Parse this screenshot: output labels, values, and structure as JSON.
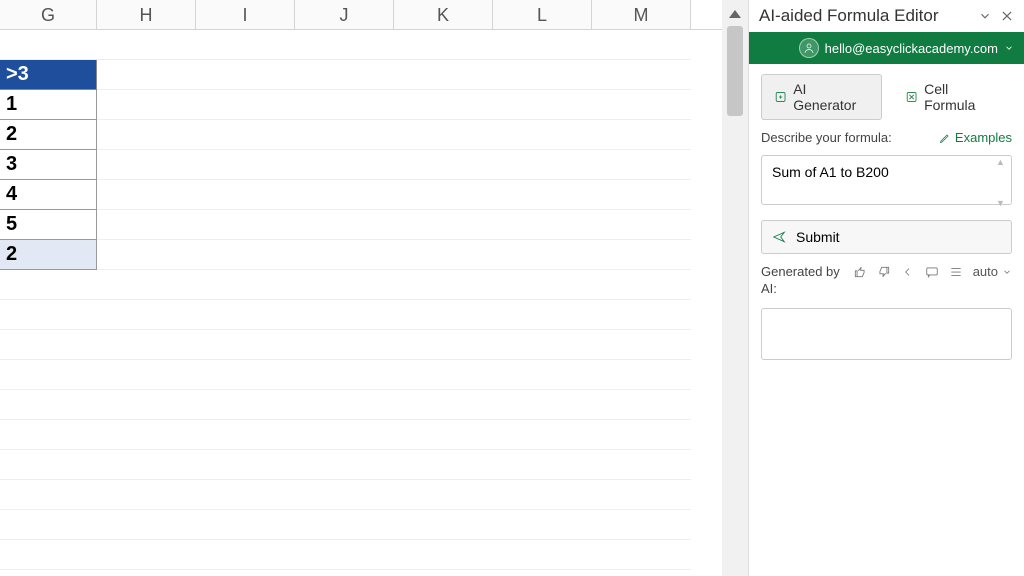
{
  "columns": [
    "G",
    "H",
    "I",
    "J",
    "K",
    "L",
    "M"
  ],
  "g_header": ">3",
  "g_values": [
    "1",
    "2",
    "3",
    "4",
    "5"
  ],
  "g_result": "2",
  "panel": {
    "title": "AI-aided Formula Editor",
    "account": "hello@easyclickacademy.com",
    "tabs": {
      "generator": "AI Generator",
      "formula": "Cell Formula"
    },
    "describe_label": "Describe your formula:",
    "examples_label": "Examples",
    "formula_text": "Sum of A1 to B200",
    "submit_label": "Submit",
    "generated_label": "Generated by AI:",
    "auto_label": "auto"
  }
}
